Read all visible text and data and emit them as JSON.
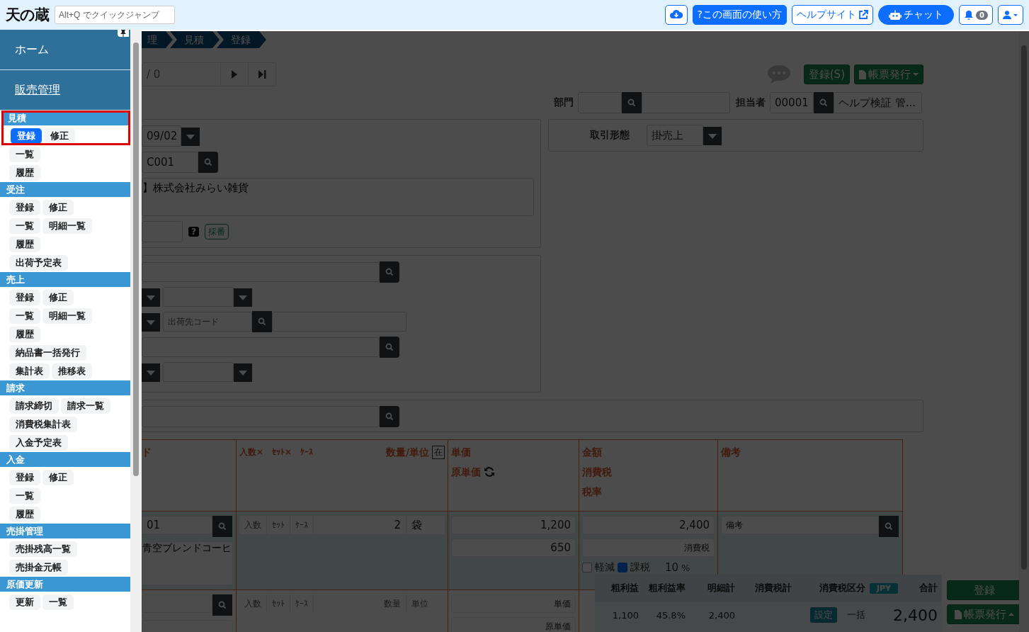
{
  "header": {
    "logo": "天の蔵",
    "quick_jump": {
      "placeholder": "Alt+Q でクイックジャンプ"
    },
    "buttons": [
      {
        "kind": "download"
      },
      {
        "kind": "help",
        "label": "?この画面の使い方"
      },
      {
        "kind": "site",
        "label": "ヘルプサイト"
      },
      {
        "kind": "chat",
        "label": "チャット"
      },
      {
        "kind": "bell",
        "label": "0"
      },
      {
        "kind": "user"
      }
    ]
  },
  "sidebar": {
    "home": "ホーム",
    "section": "販売管理",
    "groups": [
      {
        "title": "見積",
        "highlighted": true,
        "rows": [
          [
            {
              "label": "登録",
              "selected": true
            },
            {
              "label": "修正",
              "selected": false
            }
          ],
          [
            {
              "label": "一覧",
              "selected": false
            }
          ],
          [
            {
              "label": "履歴",
              "selected": false
            }
          ]
        ]
      },
      {
        "title": "受注",
        "highlighted": false,
        "rows": [
          [
            {
              "label": "登録",
              "selected": false
            },
            {
              "label": "修正",
              "selected": false
            }
          ],
          [
            {
              "label": "一覧",
              "selected": false
            },
            {
              "label": "明細一覧",
              "selected": false
            }
          ],
          [
            {
              "label": "履歴",
              "selected": false
            }
          ],
          [
            {
              "label": "出荷予定表",
              "selected": false
            }
          ]
        ]
      },
      {
        "title": "売上",
        "highlighted": false,
        "rows": [
          [
            {
              "label": "登録",
              "selected": false
            },
            {
              "label": "修正",
              "selected": false
            }
          ],
          [
            {
              "label": "一覧",
              "selected": false
            },
            {
              "label": "明細一覧",
              "selected": false
            }
          ],
          [
            {
              "label": "履歴",
              "selected": false
            }
          ],
          [
            {
              "label": "納品書一括発行",
              "selected": false
            }
          ],
          [
            {
              "label": "集計表",
              "selected": false
            },
            {
              "label": "推移表",
              "selected": false
            }
          ]
        ]
      },
      {
        "title": "請求",
        "highlighted": false,
        "rows": [
          [
            {
              "label": "請求締切",
              "selected": false
            },
            {
              "label": "請求一覧",
              "selected": false
            }
          ],
          [
            {
              "label": "消費税集計表",
              "selected": false
            }
          ],
          [
            {
              "label": "入金予定表",
              "selected": false
            }
          ]
        ]
      },
      {
        "title": "入金",
        "highlighted": false,
        "rows": [
          [
            {
              "label": "登録",
              "selected": false
            },
            {
              "label": "修正",
              "selected": false
            }
          ],
          [
            {
              "label": "一覧",
              "selected": false
            }
          ],
          [
            {
              "label": "履歴",
              "selected": false
            }
          ]
        ]
      },
      {
        "title": "売掛管理",
        "highlighted": false,
        "rows": [
          [
            {
              "label": "売掛残高一覧",
              "selected": false
            }
          ],
          [
            {
              "label": "売掛金元帳",
              "selected": false
            }
          ]
        ]
      },
      {
        "title": "原価更新",
        "highlighted": false,
        "rows": [
          [
            {
              "label": "更新",
              "selected": false
            },
            {
              "label": "一覧",
              "selected": false
            }
          ]
        ]
      }
    ]
  },
  "main": {
    "breadcrumb": [
      "理",
      "見積",
      "登録"
    ],
    "pager": "/ 0",
    "actions": {
      "save": "登録(S)",
      "report": "帳票発行"
    },
    "department": {
      "label": "部門"
    },
    "staff": {
      "label": "担当者",
      "code": "00001",
      "name": "ヘルプ検証 管..."
    },
    "date": "09/02",
    "trade_type": {
      "label": "取引形態",
      "value": "掛売上"
    },
    "customer": {
      "code": "C001",
      "name": "】株式会社みらい雑貨"
    },
    "help_mark": "?",
    "number_button": "採番",
    "ship_to": {
      "placeholder": "出荷先コード"
    },
    "table": {
      "columns": {
        "code": "ド",
        "parts": [
          "入数×",
          "ｾｯﾄ×",
          "ｹｰｽ"
        ],
        "qty": "数量/単位",
        "stock": "在",
        "price": [
          "単価",
          "原単価"
        ],
        "amount": [
          "金額",
          "消費税",
          "税率"
        ],
        "note": "備考"
      },
      "tax_labels": {
        "reduced": "軽減",
        "taxable": "課税",
        "percent": "%"
      },
      "rows": [
        {
          "code": "01",
          "name": "青空ブレンドコーヒ",
          "part_placeholders": [
            "入数",
            "ｾｯﾄ",
            "ｹｰｽ"
          ],
          "qty": "2",
          "unit": "袋",
          "price": "1,200",
          "cost": "650",
          "amount": "2,400",
          "tax_placeholder": "消費税",
          "reduced": false,
          "taxable": true,
          "rate": "10",
          "note_placeholder": "備考"
        },
        {
          "part_placeholders": [
            "入数",
            "ｾｯﾄ",
            "ｹｰｽ"
          ],
          "qty_placeholder": "数量",
          "unit_placeholder": "単位",
          "price_placeholder": "単価",
          "cost_placeholder": "原単価"
        }
      ]
    }
  },
  "summary": {
    "headers": [
      "粗利益",
      "粗利益率",
      "明細計",
      "消費税計",
      "消費税区分",
      "JPY",
      "合計"
    ],
    "profit": "1,100",
    "rate": "45.8%",
    "subtotal": "2,400",
    "set_button": "設定",
    "tax_mode": "一括",
    "total": "2,400",
    "buttons": {
      "save": "登録",
      "report": "帳票発行"
    }
  }
}
